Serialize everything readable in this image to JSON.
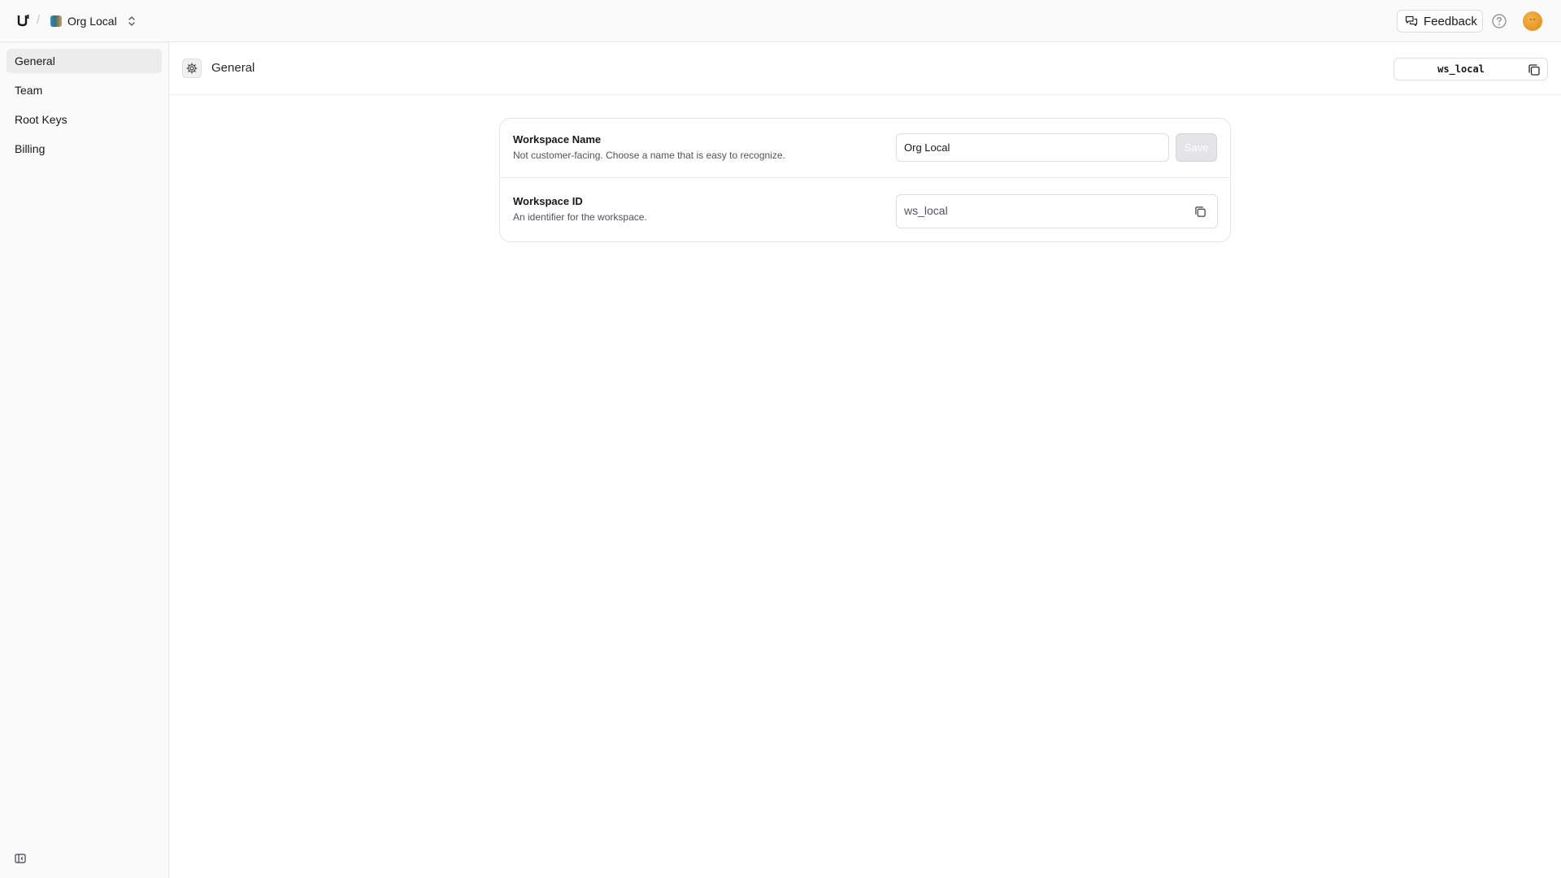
{
  "topbar": {
    "breadcrumb_separator": "/",
    "workspace_name": "Org Local",
    "feedback_label": "Feedback",
    "icons": {
      "logo": "unkey-logo-icon",
      "switcher": "chevrons-up-down-icon",
      "feedback": "message-square-icon",
      "help": "help-circle-icon"
    }
  },
  "sidebar": {
    "items": [
      {
        "label": "General",
        "active": true
      },
      {
        "label": "Team",
        "active": false
      },
      {
        "label": "Root Keys",
        "active": false
      },
      {
        "label": "Billing",
        "active": false
      }
    ],
    "collapse_icon": "sidebar-collapse-icon"
  },
  "header": {
    "title": "General",
    "icon": "gear-icon",
    "workspace_id": "ws_local",
    "copy_icon": "copy-icon"
  },
  "settings": {
    "workspace_name": {
      "title": "Workspace Name",
      "description": "Not customer-facing. Choose a name that is easy to recognize.",
      "value": "Org Local",
      "save_label": "Save"
    },
    "workspace_id": {
      "title": "Workspace ID",
      "description": "An identifier for the workspace.",
      "value": "ws_local"
    }
  },
  "colors": {
    "background": "#fafafa",
    "surface": "#ffffff",
    "border": "#e4e4e7",
    "text": "#18181b",
    "muted_text": "#52525b",
    "active_nav": "#ececed"
  }
}
